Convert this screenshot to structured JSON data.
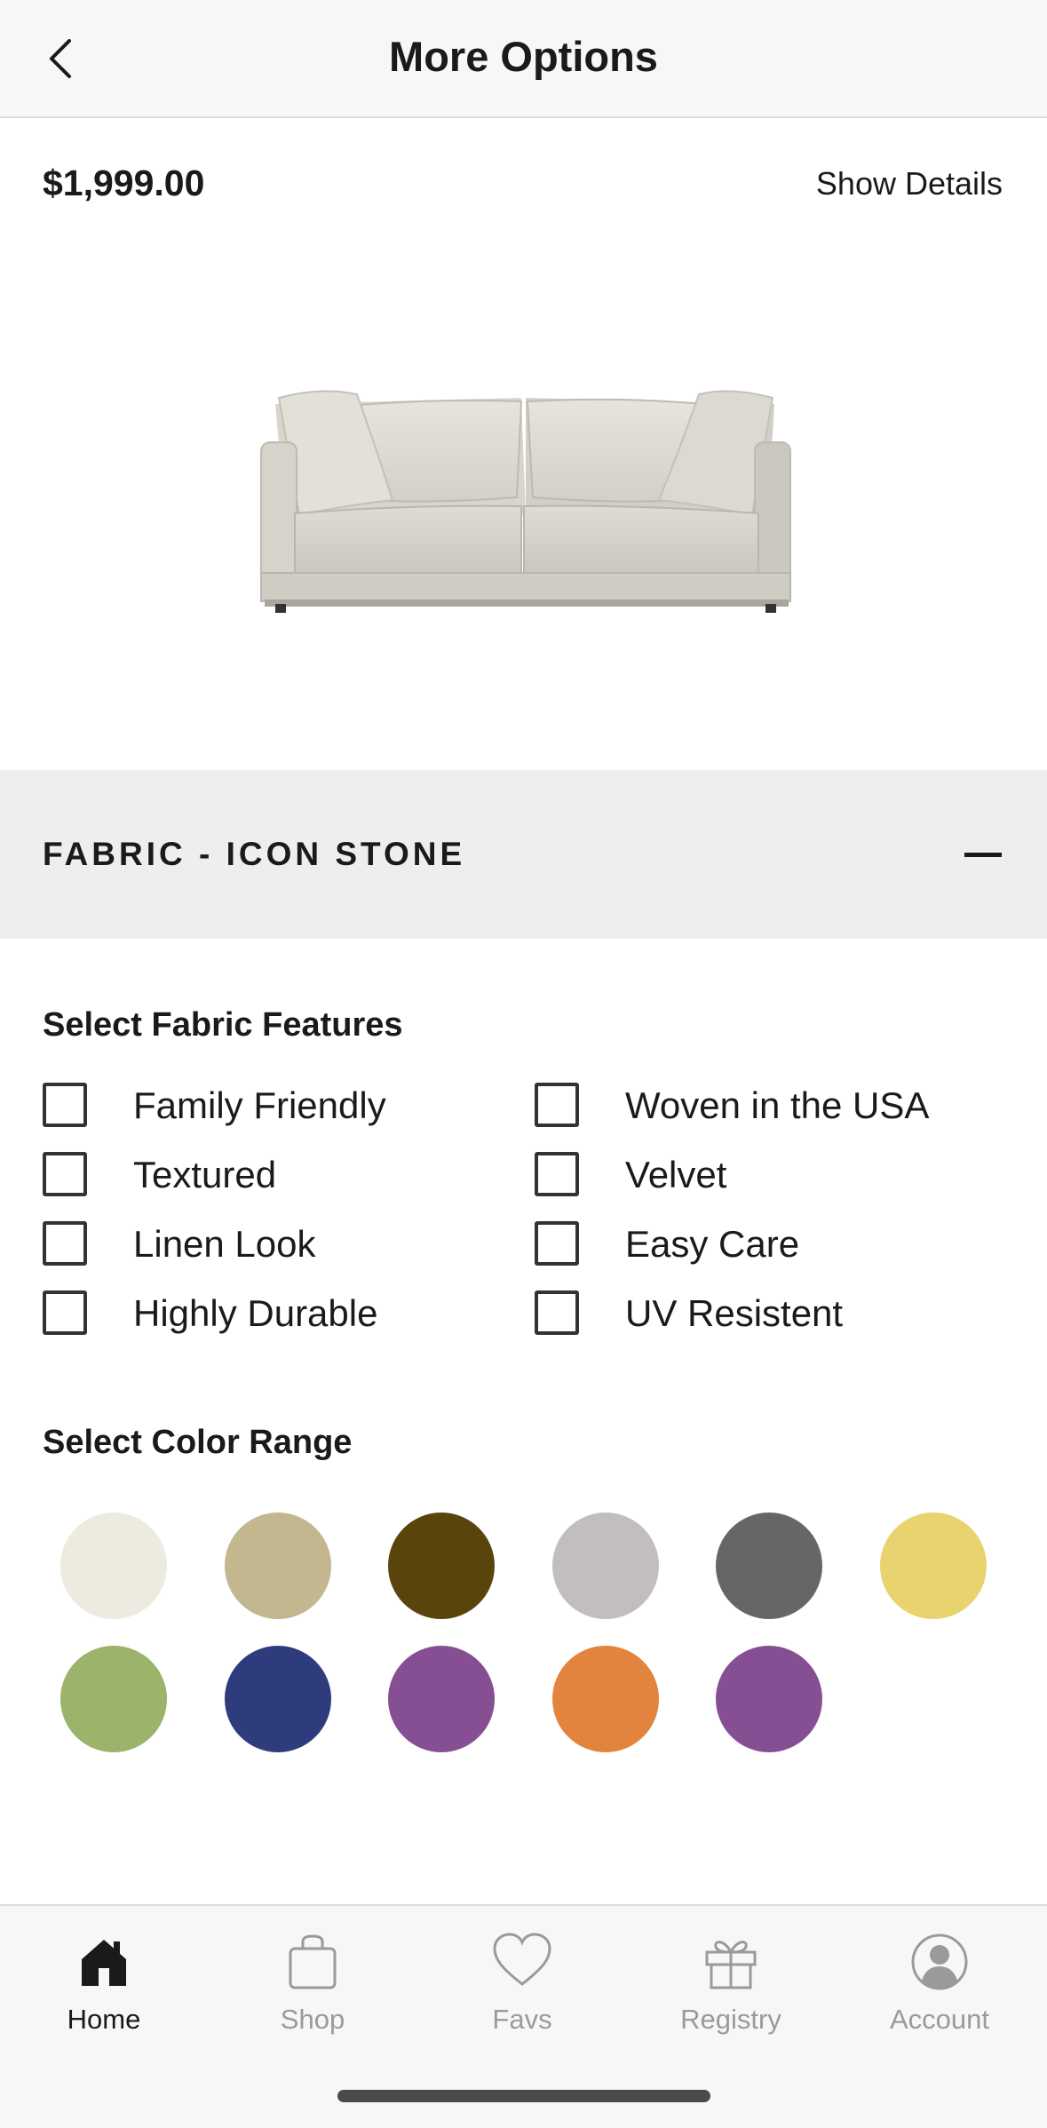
{
  "header": {
    "title": "More Options",
    "back_icon": "chevron-left-icon"
  },
  "product": {
    "price": "$1,999.00",
    "show_details_label": "Show Details",
    "image": "sofa-image"
  },
  "fabric": {
    "title": "FABRIC - ICON STONE",
    "toggle_icon": "minus-icon"
  },
  "features": {
    "label": "Select Fabric Features",
    "items": [
      {
        "label": "Family Friendly",
        "checked": false
      },
      {
        "label": "Woven in the USA",
        "checked": false
      },
      {
        "label": "Textured",
        "checked": false
      },
      {
        "label": "Velvet",
        "checked": false
      },
      {
        "label": "Linen Look",
        "checked": false
      },
      {
        "label": "Easy Care",
        "checked": false
      },
      {
        "label": "Highly Durable",
        "checked": false
      },
      {
        "label": "UV Resistent",
        "checked": false
      }
    ]
  },
  "colors": {
    "label": "Select Color Range",
    "swatches": [
      "#edeadf",
      "#c2b78f",
      "#59440c",
      "#c1bebd",
      "#666666",
      "#e8d36e",
      "#9bb36a",
      "#2e3c7e",
      "#874f93",
      "#e2843d",
      "#874f93"
    ]
  },
  "tabbar": {
    "tabs": [
      {
        "label": "Home",
        "icon": "home-icon",
        "active": true
      },
      {
        "label": "Shop",
        "icon": "shopping-bag-icon",
        "active": false
      },
      {
        "label": "Favs",
        "icon": "heart-icon",
        "active": false
      },
      {
        "label": "Registry",
        "icon": "gift-icon",
        "active": false
      },
      {
        "label": "Account",
        "icon": "account-icon",
        "active": false
      }
    ]
  }
}
